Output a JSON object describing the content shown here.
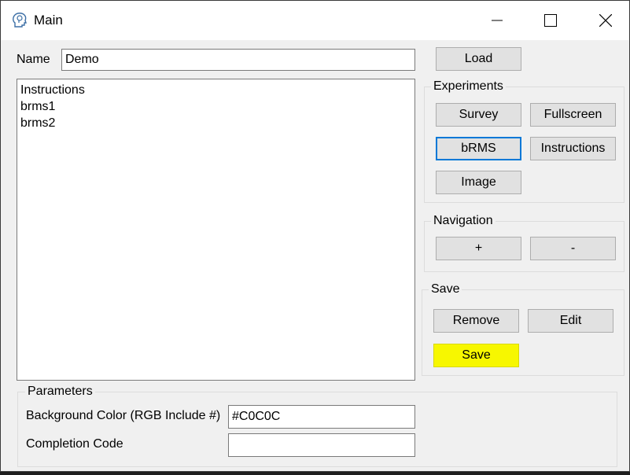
{
  "window": {
    "title": "Main",
    "icon": "head-icon"
  },
  "name_field": {
    "label": "Name",
    "value": "Demo"
  },
  "list": {
    "items": [
      "Instructions",
      "brms1",
      "brms2"
    ]
  },
  "load_button": "Load",
  "experiments": {
    "title": "Experiments",
    "survey": "Survey",
    "fullscreen": "Fullscreen",
    "brms": "bRMS",
    "instructions": "Instructions",
    "image": "Image"
  },
  "navigation": {
    "title": "Navigation",
    "plus": "+",
    "minus": "-"
  },
  "save_group": {
    "title": "Save",
    "remove": "Remove",
    "edit": "Edit",
    "save": "Save",
    "highlight_color": "#f7f700"
  },
  "parameters": {
    "title": "Parameters",
    "background_label": "Background Color (RGB Include #)",
    "background_value": "#C0C0C",
    "completion_label": "Completion Code",
    "completion_value": ""
  }
}
